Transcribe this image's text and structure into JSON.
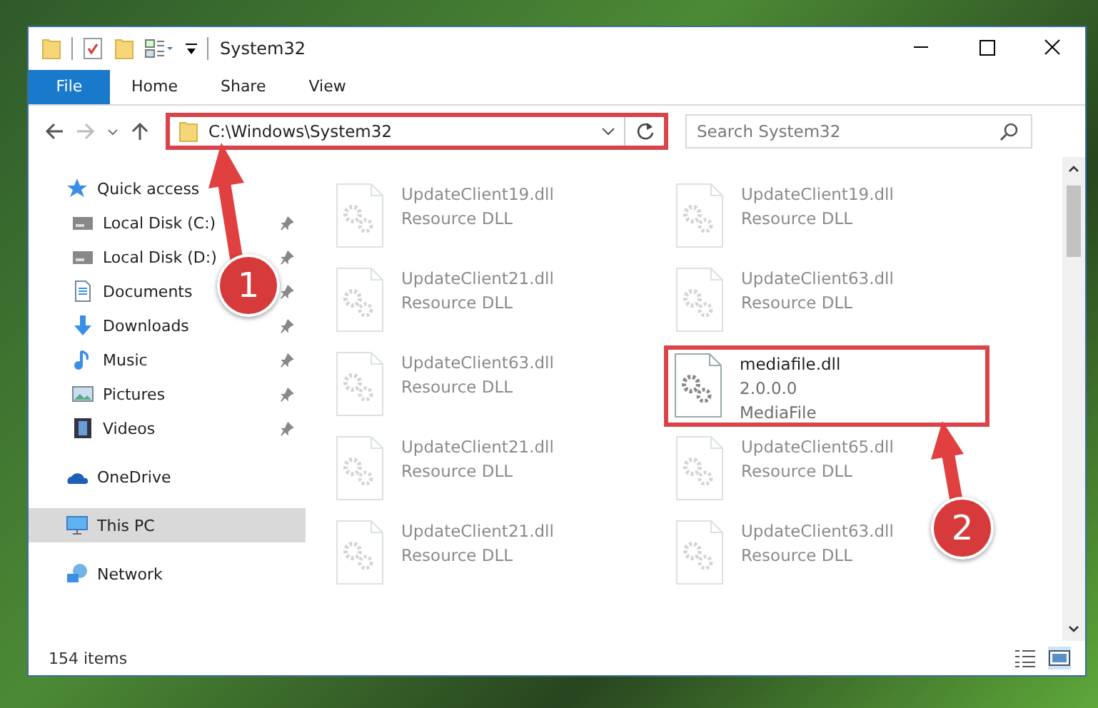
{
  "window": {
    "title": "System32"
  },
  "ribbon_tabs": [
    {
      "label": "File",
      "selected": true
    },
    {
      "label": "Home",
      "selected": false
    },
    {
      "label": "Share",
      "selected": false
    },
    {
      "label": "View",
      "selected": false
    }
  ],
  "address": {
    "value": "C:\\Windows\\System32",
    "highlighted": true
  },
  "search": {
    "placeholder": "Search System32"
  },
  "nav": [
    {
      "label": "Quick access",
      "kind": "star",
      "selected": false,
      "children": [
        {
          "label": "Local Disk (C:)",
          "kind": "disk",
          "selected": false,
          "pinned": true
        },
        {
          "label": "Local Disk (D:)",
          "kind": "disk",
          "selected": false,
          "pinned": true
        },
        {
          "label": "Documents",
          "kind": "document",
          "selected": false,
          "pinned": true
        },
        {
          "label": "Downloads",
          "kind": "download",
          "selected": false,
          "pinned": true
        },
        {
          "label": "Music",
          "kind": "music",
          "selected": false,
          "pinned": true
        },
        {
          "label": "Pictures",
          "kind": "picture",
          "selected": false,
          "pinned": true
        },
        {
          "label": "Videos",
          "kind": "video",
          "selected": false,
          "pinned": true
        }
      ]
    },
    {
      "label": "OneDrive",
      "kind": "cloud",
      "selected": false
    },
    {
      "label": "This PC",
      "kind": "pc",
      "selected": true
    },
    {
      "label": "Network",
      "kind": "network",
      "selected": false
    }
  ],
  "files": [
    {
      "name": "UpdateClient19.dll",
      "lines": [
        "Resource DLL"
      ],
      "faded": true,
      "highlighted": false
    },
    {
      "name": "UpdateClient19.dll",
      "lines": [
        "Resource DLL"
      ],
      "faded": true,
      "highlighted": false
    },
    {
      "name": "UpdateClient21.dll",
      "lines": [
        "Resource DLL"
      ],
      "faded": true,
      "highlighted": false
    },
    {
      "name": "UpdateClient63.dll",
      "lines": [
        "Resource DLL"
      ],
      "faded": true,
      "highlighted": false
    },
    {
      "name": "UpdateClient63.dll",
      "lines": [
        "Resource DLL"
      ],
      "faded": true,
      "highlighted": false
    },
    {
      "name": "mediafile.dll",
      "lines": [
        "2.0.0.0",
        "MediaFile"
      ],
      "faded": false,
      "highlighted": true
    },
    {
      "name": "UpdateClient21.dll",
      "lines": [
        "Resource DLL"
      ],
      "faded": true,
      "highlighted": false
    },
    {
      "name": "UpdateClient65.dll",
      "lines": [
        "Resource DLL"
      ],
      "faded": true,
      "highlighted": false
    },
    {
      "name": "UpdateClient21.dll",
      "lines": [
        "Resource DLL"
      ],
      "faded": true,
      "highlighted": false
    },
    {
      "name": "UpdateClient63.dll",
      "lines": [
        "Resource DLL"
      ],
      "faded": true,
      "highlighted": false
    }
  ],
  "status_bar": {
    "item_count": "154 items"
  },
  "callouts": [
    {
      "number": "1"
    },
    {
      "number": "2"
    }
  ]
}
